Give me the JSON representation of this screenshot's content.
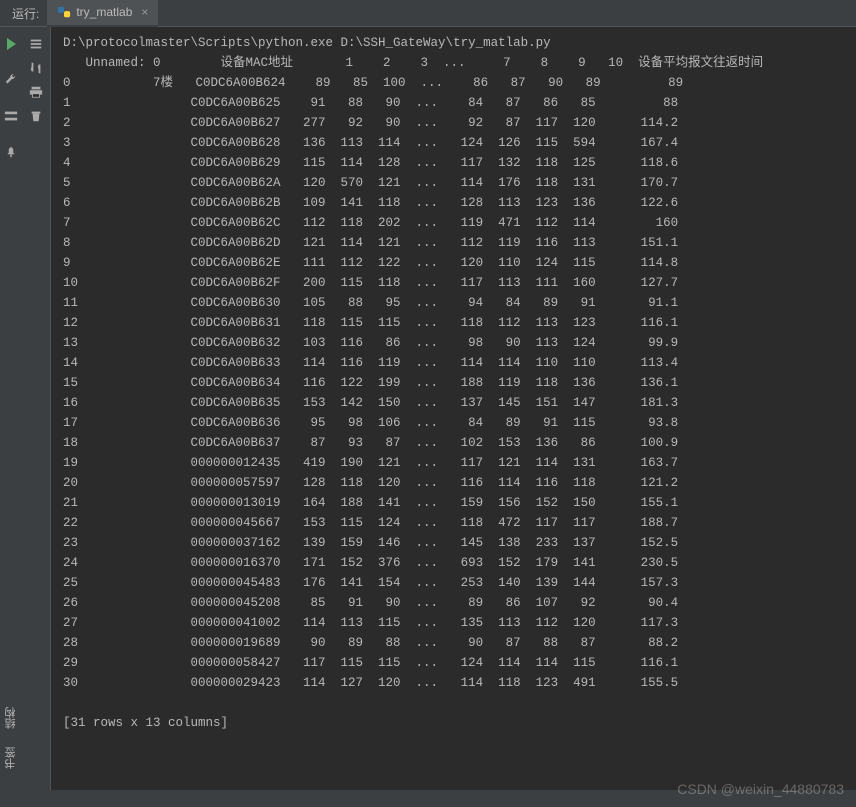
{
  "topbar": {
    "run_label": "运行:",
    "tab_name": "try_matlab",
    "tab_close": "×"
  },
  "side_tabs": {
    "bookmarks": "书签",
    "structure": "结构"
  },
  "watermark": "CSDN @weixin_44880783",
  "console": {
    "cmd": "D:\\protocolmaster\\Scripts\\python.exe D:\\SSH_GateWay\\try_matlab.py",
    "header_unnamed": "Unnamed: 0",
    "header_mac": "设备MAC地址",
    "header_avg": "设备平均报文往返时间",
    "cols_nums": [
      "1",
      "2",
      "3",
      "...",
      "7",
      "8",
      "9",
      "10"
    ],
    "rows": [
      {
        "idx": "0",
        "u": "7楼",
        "mac": "C0DC6A00B624",
        "c": [
          "89",
          "85",
          "100",
          "...",
          "86",
          "87",
          "90",
          "89"
        ],
        "avg": "89"
      },
      {
        "idx": "1",
        "u": "",
        "mac": "C0DC6A00B625",
        "c": [
          "91",
          "88",
          "90",
          "...",
          "84",
          "87",
          "86",
          "85"
        ],
        "avg": "88"
      },
      {
        "idx": "2",
        "u": "",
        "mac": "C0DC6A00B627",
        "c": [
          "277",
          "92",
          "90",
          "...",
          "92",
          "87",
          "117",
          "120"
        ],
        "avg": "114.2"
      },
      {
        "idx": "3",
        "u": "",
        "mac": "C0DC6A00B628",
        "c": [
          "136",
          "113",
          "114",
          "...",
          "124",
          "126",
          "115",
          "594"
        ],
        "avg": "167.4"
      },
      {
        "idx": "4",
        "u": "",
        "mac": "C0DC6A00B629",
        "c": [
          "115",
          "114",
          "128",
          "...",
          "117",
          "132",
          "118",
          "125"
        ],
        "avg": "118.6"
      },
      {
        "idx": "5",
        "u": "",
        "mac": "C0DC6A00B62A",
        "c": [
          "120",
          "570",
          "121",
          "...",
          "114",
          "176",
          "118",
          "131"
        ],
        "avg": "170.7"
      },
      {
        "idx": "6",
        "u": "",
        "mac": "C0DC6A00B62B",
        "c": [
          "109",
          "141",
          "118",
          "...",
          "128",
          "113",
          "123",
          "136"
        ],
        "avg": "122.6"
      },
      {
        "idx": "7",
        "u": "",
        "mac": "C0DC6A00B62C",
        "c": [
          "112",
          "118",
          "202",
          "...",
          "119",
          "471",
          "112",
          "114"
        ],
        "avg": "160"
      },
      {
        "idx": "8",
        "u": "",
        "mac": "C0DC6A00B62D",
        "c": [
          "121",
          "114",
          "121",
          "...",
          "112",
          "119",
          "116",
          "113"
        ],
        "avg": "151.1"
      },
      {
        "idx": "9",
        "u": "",
        "mac": "C0DC6A00B62E",
        "c": [
          "111",
          "112",
          "122",
          "...",
          "120",
          "110",
          "124",
          "115"
        ],
        "avg": "114.8"
      },
      {
        "idx": "10",
        "u": "",
        "mac": "C0DC6A00B62F",
        "c": [
          "200",
          "115",
          "118",
          "...",
          "117",
          "113",
          "111",
          "160"
        ],
        "avg": "127.7"
      },
      {
        "idx": "11",
        "u": "",
        "mac": "C0DC6A00B630",
        "c": [
          "105",
          "88",
          "95",
          "...",
          "94",
          "84",
          "89",
          "91"
        ],
        "avg": "91.1"
      },
      {
        "idx": "12",
        "u": "",
        "mac": "C0DC6A00B631",
        "c": [
          "118",
          "115",
          "115",
          "...",
          "118",
          "112",
          "113",
          "123"
        ],
        "avg": "116.1"
      },
      {
        "idx": "13",
        "u": "",
        "mac": "C0DC6A00B632",
        "c": [
          "103",
          "116",
          "86",
          "...",
          "98",
          "90",
          "113",
          "124"
        ],
        "avg": "99.9"
      },
      {
        "idx": "14",
        "u": "",
        "mac": "C0DC6A00B633",
        "c": [
          "114",
          "116",
          "119",
          "...",
          "114",
          "114",
          "110",
          "110"
        ],
        "avg": "113.4"
      },
      {
        "idx": "15",
        "u": "",
        "mac": "C0DC6A00B634",
        "c": [
          "116",
          "122",
          "199",
          "...",
          "188",
          "119",
          "118",
          "136"
        ],
        "avg": "136.1"
      },
      {
        "idx": "16",
        "u": "",
        "mac": "C0DC6A00B635",
        "c": [
          "153",
          "142",
          "150",
          "...",
          "137",
          "145",
          "151",
          "147"
        ],
        "avg": "181.3"
      },
      {
        "idx": "17",
        "u": "",
        "mac": "C0DC6A00B636",
        "c": [
          "95",
          "98",
          "106",
          "...",
          "84",
          "89",
          "91",
          "115"
        ],
        "avg": "93.8"
      },
      {
        "idx": "18",
        "u": "",
        "mac": "C0DC6A00B637",
        "c": [
          "87",
          "93",
          "87",
          "...",
          "102",
          "153",
          "136",
          "86"
        ],
        "avg": "100.9"
      },
      {
        "idx": "19",
        "u": "",
        "mac": "000000012435",
        "c": [
          "419",
          "190",
          "121",
          "...",
          "117",
          "121",
          "114",
          "131"
        ],
        "avg": "163.7"
      },
      {
        "idx": "20",
        "u": "",
        "mac": "000000057597",
        "c": [
          "128",
          "118",
          "120",
          "...",
          "116",
          "114",
          "116",
          "118"
        ],
        "avg": "121.2"
      },
      {
        "idx": "21",
        "u": "",
        "mac": "000000013019",
        "c": [
          "164",
          "188",
          "141",
          "...",
          "159",
          "156",
          "152",
          "150"
        ],
        "avg": "155.1"
      },
      {
        "idx": "22",
        "u": "",
        "mac": "000000045667",
        "c": [
          "153",
          "115",
          "124",
          "...",
          "118",
          "472",
          "117",
          "117"
        ],
        "avg": "188.7"
      },
      {
        "idx": "23",
        "u": "",
        "mac": "000000037162",
        "c": [
          "139",
          "159",
          "146",
          "...",
          "145",
          "138",
          "233",
          "137"
        ],
        "avg": "152.5"
      },
      {
        "idx": "24",
        "u": "",
        "mac": "000000016370",
        "c": [
          "171",
          "152",
          "376",
          "...",
          "693",
          "152",
          "179",
          "141"
        ],
        "avg": "230.5"
      },
      {
        "idx": "25",
        "u": "",
        "mac": "000000045483",
        "c": [
          "176",
          "141",
          "154",
          "...",
          "253",
          "140",
          "139",
          "144"
        ],
        "avg": "157.3"
      },
      {
        "idx": "26",
        "u": "",
        "mac": "000000045208",
        "c": [
          "85",
          "91",
          "90",
          "...",
          "89",
          "86",
          "107",
          "92"
        ],
        "avg": "90.4"
      },
      {
        "idx": "27",
        "u": "",
        "mac": "000000041002",
        "c": [
          "114",
          "113",
          "115",
          "...",
          "135",
          "113",
          "112",
          "120"
        ],
        "avg": "117.3"
      },
      {
        "idx": "28",
        "u": "",
        "mac": "000000019689",
        "c": [
          "90",
          "89",
          "88",
          "...",
          "90",
          "87",
          "88",
          "87"
        ],
        "avg": "88.2"
      },
      {
        "idx": "29",
        "u": "",
        "mac": "000000058427",
        "c": [
          "117",
          "115",
          "115",
          "...",
          "124",
          "114",
          "114",
          "115"
        ],
        "avg": "116.1"
      },
      {
        "idx": "30",
        "u": "",
        "mac": "000000029423",
        "c": [
          "114",
          "127",
          "120",
          "...",
          "114",
          "118",
          "123",
          "491"
        ],
        "avg": "155.5"
      }
    ],
    "footer": "[31 rows x 13 columns]"
  }
}
